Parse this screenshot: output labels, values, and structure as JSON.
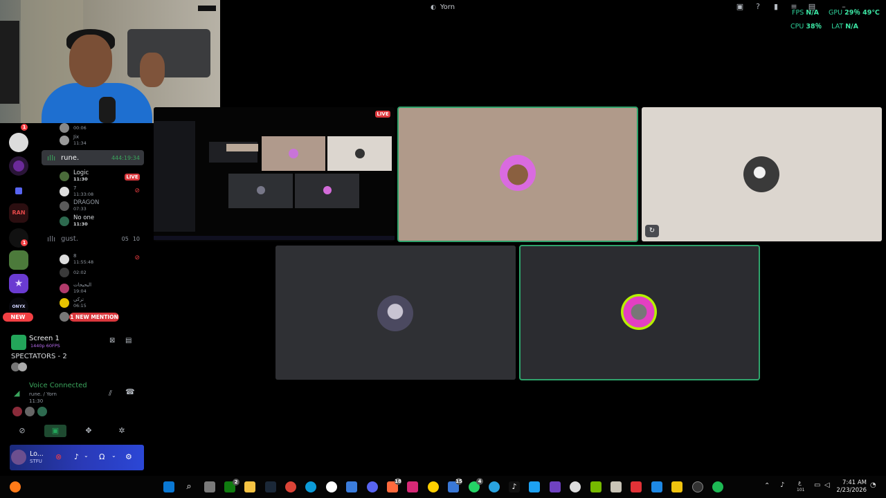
{
  "window": {
    "title": "Yorn"
  },
  "overlay": {
    "fps_label": "FPS",
    "fps_value": "N/A",
    "gpu_label": "GPU",
    "gpu_value": "29％ 49℃",
    "cpu_label": "CPU",
    "cpu_value": "38％",
    "lat_label": "LAT",
    "lat_value": "N/A"
  },
  "servers": {
    "badges": [
      "1",
      "1"
    ],
    "labels": [
      "RAN",
      "ONYX"
    ],
    "new_label": "NEW"
  },
  "channels": {
    "top_users": [
      {
        "name": "",
        "time": "00:06"
      },
      {
        "name": "Jix",
        "time": "11:34"
      }
    ],
    "rune": {
      "name": "rune.",
      "timer": "444:19:34",
      "live_label": "LIVE",
      "users": [
        {
          "name": "Logic",
          "time": "11:30"
        },
        {
          "name": "7",
          "time": "11:33:08"
        },
        {
          "name": "DRAGON",
          "time": "07:33"
        },
        {
          "name": "No one",
          "time": "11:30"
        }
      ]
    },
    "gust": {
      "name": "gust.",
      "count_a": "05",
      "count_b": "10",
      "users": [
        {
          "name": "8",
          "time": "11:55:48"
        },
        {
          "name": "",
          "time": "02:02"
        },
        {
          "name": "البحيحات",
          "time": "19:04"
        },
        {
          "name": "تركي",
          "time": "06:15"
        }
      ],
      "mention_label": "1 NEW MENTION"
    }
  },
  "screen_panel": {
    "title": "Screen 1",
    "sub": "1440p 60FPS",
    "spectators": "SPECTATORS - 2"
  },
  "voice": {
    "status": "Voice Connected",
    "path": "rune. / Yorn",
    "time": "11:30"
  },
  "user": {
    "name": "Lo...",
    "status": "STFU"
  },
  "stream": {
    "live_label": "LIVE"
  },
  "taskbar": {
    "time": "7:41 AM",
    "date": "2/23/2026",
    "lang": "ع",
    "badges": [
      "2",
      "18",
      "15",
      "4"
    ],
    "misc": "101"
  },
  "colors": {
    "speaking": "#2fa36b",
    "voice_green": "#3ba55d",
    "danger": "#da373c",
    "overlay_green": "#2fd19a"
  }
}
